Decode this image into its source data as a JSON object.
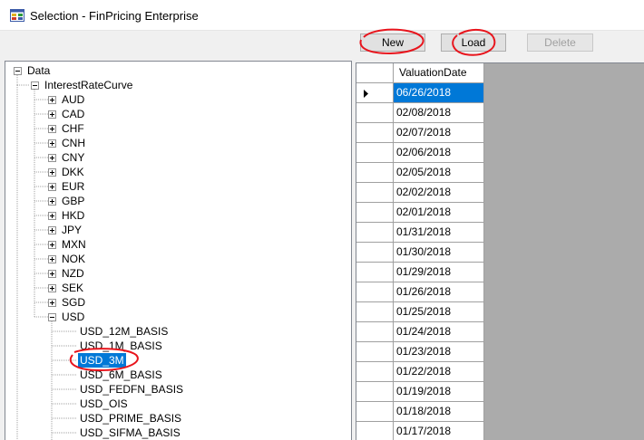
{
  "window": {
    "title": "Selection - FinPricing Enterprise",
    "icon": "app-window-icon"
  },
  "toolbar": {
    "new_label": "New",
    "load_label": "Load",
    "delete_label": "Delete"
  },
  "tree": {
    "root": "Data",
    "curve_type": "InterestRateCurve",
    "currencies": [
      "AUD",
      "CAD",
      "CHF",
      "CNH",
      "CNY",
      "DKK",
      "EUR",
      "GBP",
      "HKD",
      "JPY",
      "MXN",
      "NOK",
      "NZD",
      "SEK",
      "SGD",
      "USD"
    ],
    "usd_children": [
      "USD_12M_BASIS",
      "USD_1M_BASIS",
      "USD_3M",
      "USD_6M_BASIS",
      "USD_FEDFN_BASIS",
      "USD_OIS",
      "USD_PRIME_BASIS",
      "USD_SIFMA_BASIS"
    ],
    "selected": "USD_3M"
  },
  "grid": {
    "column_header": "ValuationDate",
    "rows": [
      "06/26/2018",
      "02/08/2018",
      "02/07/2018",
      "02/06/2018",
      "02/05/2018",
      "02/02/2018",
      "02/01/2018",
      "01/31/2018",
      "01/30/2018",
      "01/29/2018",
      "01/26/2018",
      "01/25/2018",
      "01/24/2018",
      "01/23/2018",
      "01/22/2018",
      "01/19/2018",
      "01/18/2018",
      "01/17/2018"
    ],
    "selected_row": 0
  },
  "colors": {
    "selection": "#0078d7",
    "annotation": "#e8141c",
    "grid_background": "#ababab"
  }
}
